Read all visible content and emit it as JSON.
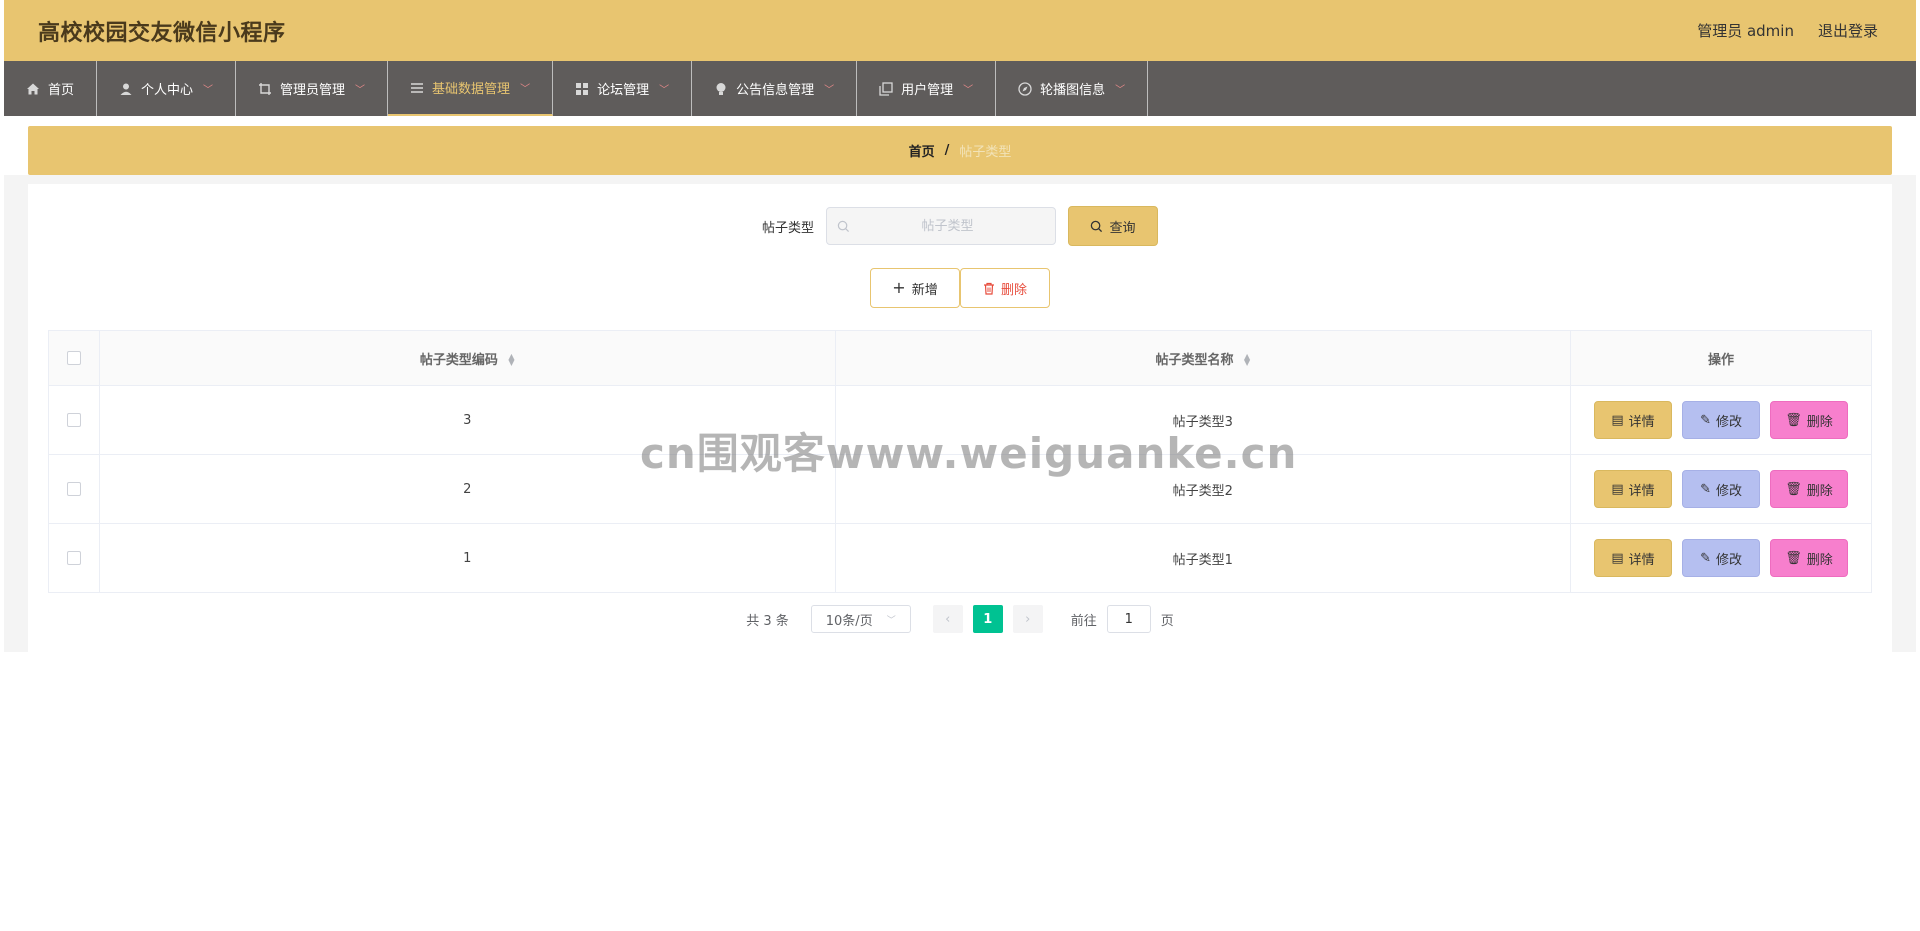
{
  "app": {
    "title": "高校校园交友微信小程序",
    "user_label": "管理员 admin",
    "logout_label": "退出登录"
  },
  "nav": {
    "items": [
      {
        "label": "首页",
        "icon": "home-icon",
        "has_dropdown": false,
        "active": false
      },
      {
        "label": "个人中心",
        "icon": "user-icon",
        "has_dropdown": true,
        "active": false
      },
      {
        "label": "管理员管理",
        "icon": "crop-icon",
        "has_dropdown": true,
        "active": false
      },
      {
        "label": "基础数据管理",
        "icon": "list-icon",
        "has_dropdown": true,
        "active": true
      },
      {
        "label": "论坛管理",
        "icon": "grid-icon",
        "has_dropdown": true,
        "active": false
      },
      {
        "label": "公告信息管理",
        "icon": "bulb-icon",
        "has_dropdown": true,
        "active": false
      },
      {
        "label": "用户管理",
        "icon": "copy-icon",
        "has_dropdown": true,
        "active": false
      },
      {
        "label": "轮播图信息",
        "icon": "compass-icon",
        "has_dropdown": true,
        "active": false
      }
    ]
  },
  "breadcrumb": {
    "home": "首页",
    "separator": "/",
    "current": "帖子类型"
  },
  "search": {
    "label": "帖子类型",
    "placeholder": "帖子类型",
    "query_label": "查询"
  },
  "actions": {
    "add_label": "新增",
    "delete_label": "删除"
  },
  "table": {
    "columns": [
      "帖子类型编码",
      "帖子类型名称",
      "操作"
    ],
    "rows": [
      {
        "code": "3",
        "name": "帖子类型3"
      },
      {
        "code": "2",
        "name": "帖子类型2"
      },
      {
        "code": "1",
        "name": "帖子类型1"
      }
    ],
    "row_actions": {
      "detail": "详情",
      "edit": "修改",
      "delete": "删除"
    }
  },
  "pagination": {
    "total_text": "共 3 条",
    "page_size": "10条/页",
    "current_page": "1",
    "goto_prefix": "前往",
    "goto_value": "1",
    "goto_suffix": "页"
  },
  "watermark": "cn围观客www.weiguanke.cn",
  "colors": {
    "header": "#e8c570",
    "nav": "#5f5c5b",
    "active_page": "#00c292",
    "detail_btn": "#e8c570",
    "edit_btn": "#b5bff0",
    "delete_btn": "#f77fcd"
  }
}
